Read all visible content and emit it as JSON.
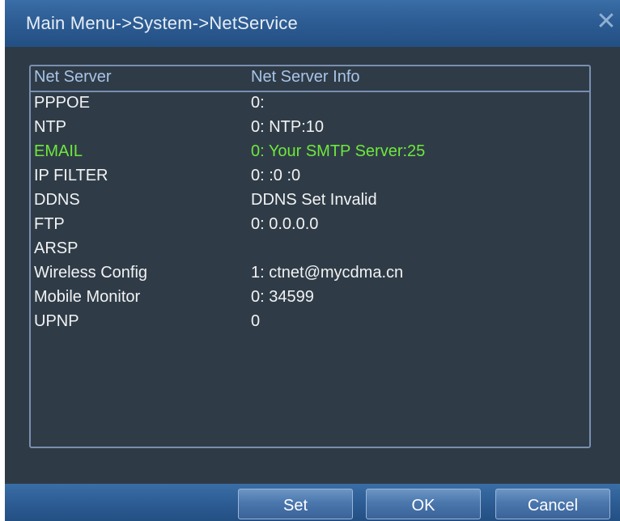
{
  "window": {
    "title": "Main Menu->System->NetService",
    "close_icon": "close-icon"
  },
  "table": {
    "headers": [
      "Net Server",
      "Net Server Info"
    ],
    "rows": [
      {
        "server": "PPPOE",
        "info": "0:"
      },
      {
        "server": "NTP",
        "info": "0: NTP:10"
      },
      {
        "server": "EMAIL",
        "info": "0: Your SMTP Server:25"
      },
      {
        "server": "IP FILTER",
        "info": "0: :0 :0"
      },
      {
        "server": "DDNS",
        "info": "DDNS Set Invalid"
      },
      {
        "server": "FTP",
        "info": "0: 0.0.0.0"
      },
      {
        "server": "ARSP",
        "info": ""
      },
      {
        "server": "Wireless Config",
        "info": "1: ctnet@mycdma.cn"
      },
      {
        "server": "Mobile Monitor",
        "info": "0: 34599"
      },
      {
        "server": "UPNP",
        "info": "0"
      }
    ],
    "selected_row": "EMAIL",
    "selected_color": "#6ee83a"
  },
  "buttons": {
    "set_label": "Set",
    "ok_label": "OK",
    "cancel_label": "Cancel"
  }
}
